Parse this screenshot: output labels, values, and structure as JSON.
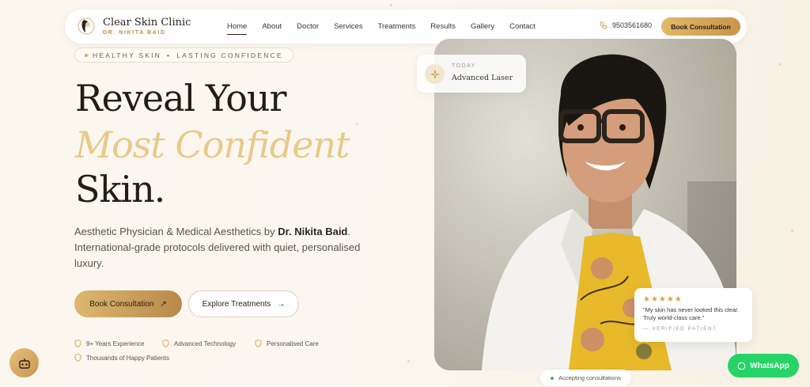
{
  "header": {
    "brand": "Clear Skin Clinic",
    "brand_sub": "DR. NIKITA BAID",
    "menu": [
      "Home",
      "About",
      "Doctor",
      "Services",
      "Treatments",
      "Results",
      "Gallery",
      "Contact"
    ],
    "active_item": "Home",
    "phone": "9503561680",
    "cta": "Book Consultation"
  },
  "hero": {
    "tagline_left": "HEALTHY SKIN",
    "tagline_sep": "•",
    "tagline_right": "LASTING CONFIDENCE",
    "title_line1": "Reveal Your",
    "title_line2": "Most Confident",
    "title_line3": "Skin.",
    "desc_pre": "Aesthetic Physician & Medical Aesthetics by ",
    "desc_name": "Dr. Nikita Baid",
    "desc_post": ". International-grade protocols delivered with quiet, personalised luxury.",
    "cta_primary": "Book Consultation",
    "cta_primary_icon": "↗",
    "cta_secondary": "Explore Treatments",
    "cta_secondary_icon": "→",
    "features": [
      "9+ Years Experience",
      "Advanced Technology",
      "Personalised Care",
      "Thousands of Happy Patients"
    ]
  },
  "today_card": {
    "label": "TODAY",
    "value": "Advanced Laser"
  },
  "review": {
    "stars": "★★★★★",
    "text": "\"My skin has never looked this clear. Truly world-class care.\"",
    "by": "— VERIFIED PATIENT"
  },
  "status": "Accepting consultations",
  "whatsapp": "WhatsApp",
  "colors": {
    "gold": "#c8944a",
    "whatsapp": "#25d366",
    "accent_light": "#e9c98a"
  }
}
